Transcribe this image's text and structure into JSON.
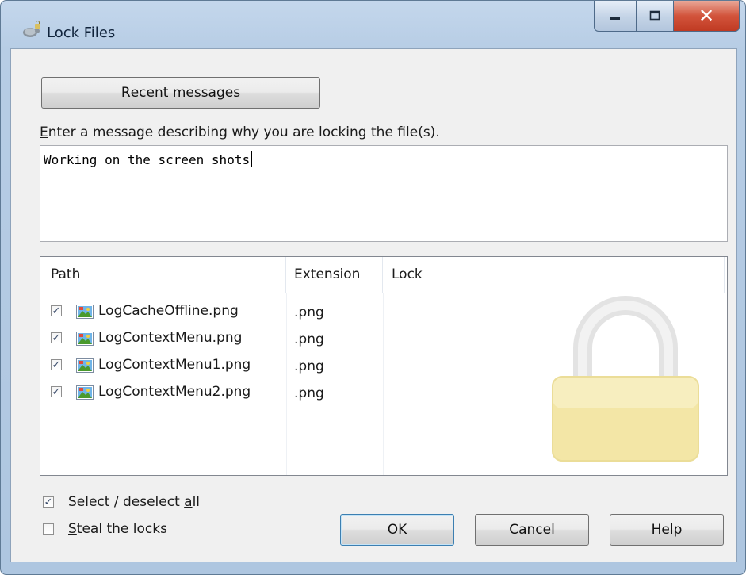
{
  "window": {
    "title": "Lock Files",
    "icon": "tortoise-lock-icon",
    "controls": {
      "minimize": "minimize-icon",
      "maximize": "maximize-icon",
      "close": "close-icon"
    }
  },
  "recent_button": {
    "prefix": "R",
    "rest": "ecent messages"
  },
  "prompt": {
    "prefix": "E",
    "rest": "nter a message describing why you are locking the file(s)."
  },
  "message": {
    "value": "Working on the screen shots"
  },
  "list": {
    "columns": [
      "Path",
      "Extension",
      "Lock"
    ],
    "rows": [
      {
        "checked": true,
        "name": "LogCacheOffline.png",
        "extension": ".png",
        "lock": ""
      },
      {
        "checked": true,
        "name": "LogContextMenu.png",
        "extension": ".png",
        "lock": ""
      },
      {
        "checked": true,
        "name": "LogContextMenu1.png",
        "extension": ".png",
        "lock": ""
      },
      {
        "checked": true,
        "name": "LogContextMenu2.png",
        "extension": ".png",
        "lock": ""
      }
    ]
  },
  "select_all": {
    "checked": true,
    "before": "Select / deselect ",
    "accel": "a",
    "after": "ll"
  },
  "steal": {
    "checked": false,
    "accel": "S",
    "after": "teal the locks"
  },
  "buttons": {
    "ok": "OK",
    "cancel": "Cancel",
    "help": "Help"
  },
  "colors": {
    "title_bar": "#b7cde5",
    "close_button": "#c9432b",
    "client_bg": "#f0f0f0",
    "lock_watermark": "#f3e6a6"
  }
}
